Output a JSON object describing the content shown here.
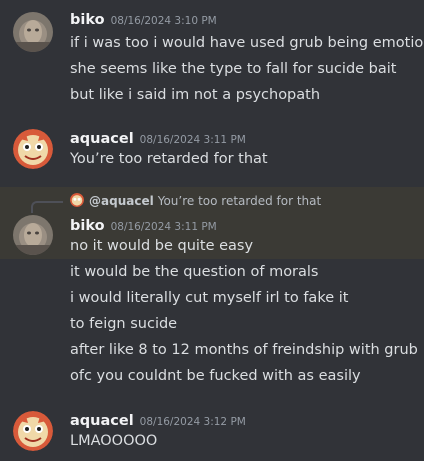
{
  "messages": [
    {
      "username": "biko",
      "timestamp": "08/16/2024 3:10 PM",
      "avatar_icon": "blurry-face-avatar",
      "lines": [
        "if i was too i would have used grub being emotional",
        "she seems like the type to fall for sucide bait",
        "but like i said im not a psychopath"
      ]
    },
    {
      "username": "aquacel",
      "timestamp": "08/16/2024 3:11 PM",
      "avatar_icon": "cartoon-cat-avatar",
      "lines": [
        "You’re too retarded for that"
      ]
    },
    {
      "reply": {
        "username": "@aquacel",
        "text": "You’re too retarded for that"
      },
      "username": "biko",
      "timestamp": "08/16/2024 3:11 PM",
      "avatar_icon": "blurry-face-avatar",
      "lines": [
        "no it would be quite easy",
        "it would be the question of morals",
        "i would literally cut myself irl to fake it",
        "to feign sucide",
        "after like 8 to 12 months of freindship with grub",
        "ofc you couldnt be fucked with as easily"
      ]
    },
    {
      "username": "aquacel",
      "timestamp": "08/16/2024 3:12 PM",
      "avatar_icon": "cartoon-cat-avatar",
      "lines": [
        "LMAOOOOO"
      ]
    }
  ],
  "colors": {
    "background": "#313338",
    "highlight": "#3b3a35",
    "text": "#dbdee1",
    "username": "#f2f3f5",
    "timestamp": "#949ba4"
  }
}
